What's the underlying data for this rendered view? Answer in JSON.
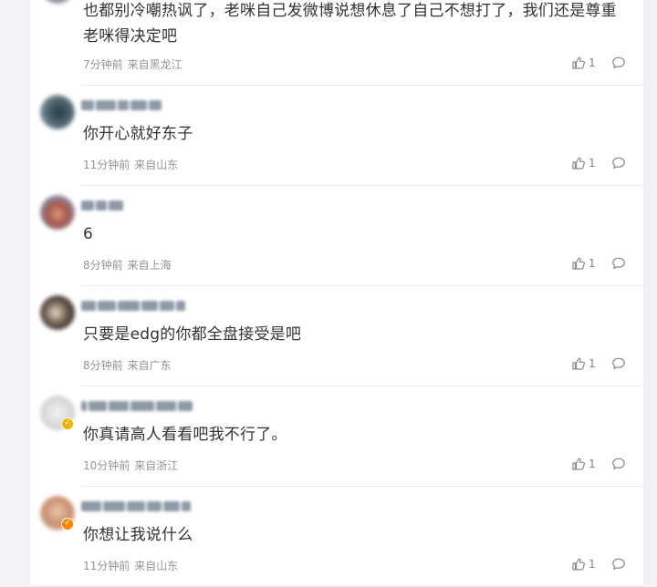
{
  "colors": {
    "page_background": "#f1f2f5",
    "card_background": "#ffffff",
    "comment_text": "#333333",
    "meta_text": "#939393",
    "vip_badge_yellow": "#f0b400",
    "vip_badge_orange": "#ff8200"
  },
  "comments": [
    {
      "username": "",
      "avatar": "blurred-avatar",
      "text": "也都别冷嘲热讽了，老咪自己发微博说想休息了自己不想打了，我们还是尊重老咪得决定吧",
      "time": "7分钟前",
      "location": "来自黑龙江",
      "likes": "1",
      "like_icon": "thumbs-up-icon",
      "reply_icon": "comment-bubble-icon"
    },
    {
      "username": "",
      "avatar": "blurred-avatar",
      "text": "你开心就好东子",
      "time": "11分钟前",
      "location": "来自山东",
      "likes": "1",
      "like_icon": "thumbs-up-icon",
      "reply_icon": "comment-bubble-icon"
    },
    {
      "username": "",
      "avatar": "blurred-avatar",
      "text": "6",
      "time": "8分钟前",
      "location": "来自上海",
      "likes": "1",
      "like_icon": "thumbs-up-icon",
      "reply_icon": "comment-bubble-icon"
    },
    {
      "username": "",
      "avatar": "blurred-avatar",
      "text": "只要是edg的你都全盘接受是吧",
      "time": "8分钟前",
      "location": "来自广东",
      "likes": "1",
      "like_icon": "thumbs-up-icon",
      "reply_icon": "comment-bubble-icon"
    },
    {
      "username": "",
      "avatar": "blurred-avatar-vip",
      "text": "你真请高人看看吧我不行了。",
      "time": "10分钟前",
      "location": "来自浙江",
      "likes": "1",
      "like_icon": "thumbs-up-icon",
      "reply_icon": "comment-bubble-icon"
    },
    {
      "username": "",
      "avatar": "blurred-avatar-vip",
      "text": "你想让我说什么",
      "time": "11分钟前",
      "location": "来自山东",
      "likes": "1",
      "like_icon": "thumbs-up-icon",
      "reply_icon": "comment-bubble-icon"
    }
  ]
}
